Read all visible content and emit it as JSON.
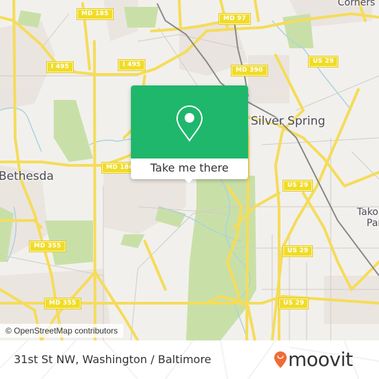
{
  "map": {
    "road_labels": [
      {
        "text": "MD 185"
      },
      {
        "text": "I 495"
      },
      {
        "text": "I 495"
      },
      {
        "text": "MD 97"
      },
      {
        "text": "MD 390"
      },
      {
        "text": "US 29"
      },
      {
        "text": "MD 186"
      },
      {
        "text": "US 29"
      },
      {
        "text": "MD 355"
      },
      {
        "text": "MD 355"
      },
      {
        "text": "US 29"
      },
      {
        "text": "US 29"
      }
    ],
    "place_labels": {
      "silver_spring": "Silver Spring",
      "bethesda": "Bethesda",
      "takoma_park_1": "Takoma",
      "takoma_park_2": "Park",
      "four_corners": "Corners"
    },
    "attribution": "© OpenStreetMap contributors",
    "colors": {
      "land": "#f2f0ec",
      "park": "#c8e0a8",
      "urban": "#e8e0dc",
      "road_major": "#f5dc5a",
      "water": "#aad3df",
      "rail": "#777777"
    }
  },
  "popup": {
    "icon": "location-pin-icon",
    "button_label": "Take me there",
    "color": "#1fb76c"
  },
  "footer": {
    "address": "31st St NW, Washington / Baltimore",
    "brand": "moovit",
    "brand_color": "#f26a36"
  }
}
